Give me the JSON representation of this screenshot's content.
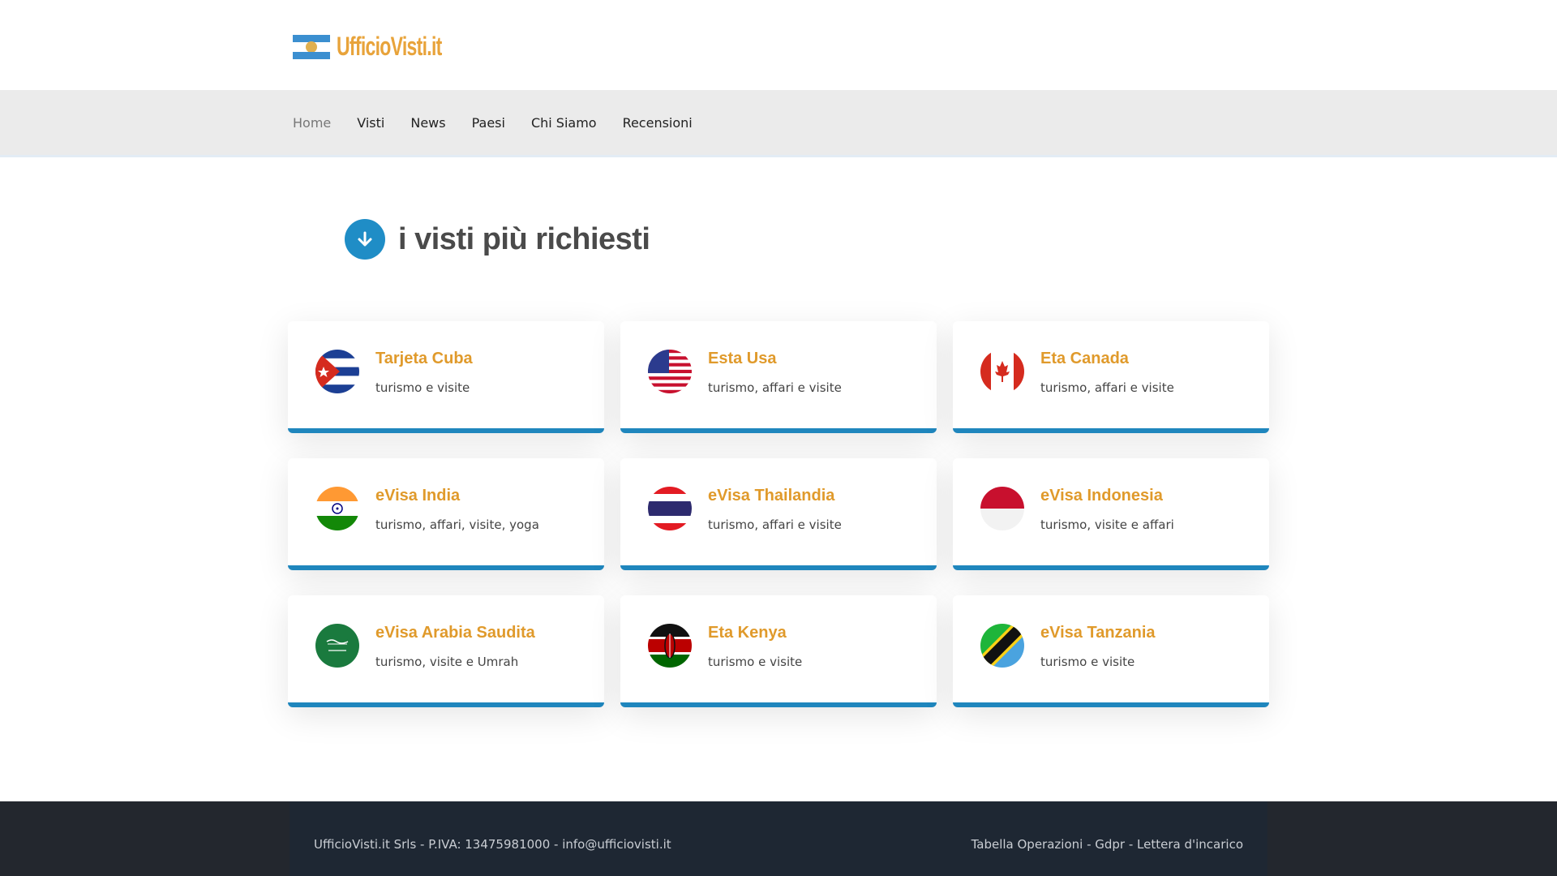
{
  "logo": {
    "part1": "UfficioVisti",
    "part2": ".it"
  },
  "nav": {
    "items": [
      {
        "label": "Home",
        "active": true
      },
      {
        "label": "Visti"
      },
      {
        "label": "News"
      },
      {
        "label": "Paesi"
      },
      {
        "label": "Chi Siamo"
      },
      {
        "label": "Recensioni"
      }
    ]
  },
  "section": {
    "title": "i visti più richiesti",
    "icon": "arrow-down-icon"
  },
  "cards": [
    {
      "name": "Tarjeta Cuba",
      "desc": "turismo e visite",
      "flag": "cuba-flag-icon"
    },
    {
      "name": "Esta Usa",
      "desc": "turismo, affari e visite",
      "flag": "usa-flag-icon"
    },
    {
      "name": "Eta Canada",
      "desc": "turismo, affari e visite",
      "flag": "canada-flag-icon"
    },
    {
      "name": "eVisa India",
      "desc": "turismo, affari, visite, yoga",
      "flag": "india-flag-icon"
    },
    {
      "name": "eVisa Thailandia",
      "desc": "turismo, affari e visite",
      "flag": "thailand-flag-icon"
    },
    {
      "name": "eVisa Indonesia",
      "desc": "turismo, visite e affari",
      "flag": "indonesia-flag-icon"
    },
    {
      "name": "eVisa Arabia Saudita",
      "desc": "turismo, visite e Umrah",
      "flag": "saudi-arabia-flag-icon"
    },
    {
      "name": "Eta Kenya",
      "desc": "turismo e visite",
      "flag": "kenya-flag-icon"
    },
    {
      "name": "eVisa Tanzania",
      "desc": "turismo e visite",
      "flag": "tanzania-flag-icon"
    }
  ],
  "footer": {
    "left": "UfficioVisti.it Srls  - P.IVA:  13475981000 - info@ufficiovisti.it",
    "right": "Tabella Operazioni - Gdpr - Lettera d'incarico"
  },
  "colors": {
    "accent": "#1f86bd",
    "card_title": "#e09a2b",
    "footer_bg": "#1e2733",
    "nav_bg": "#ebebeb"
  }
}
